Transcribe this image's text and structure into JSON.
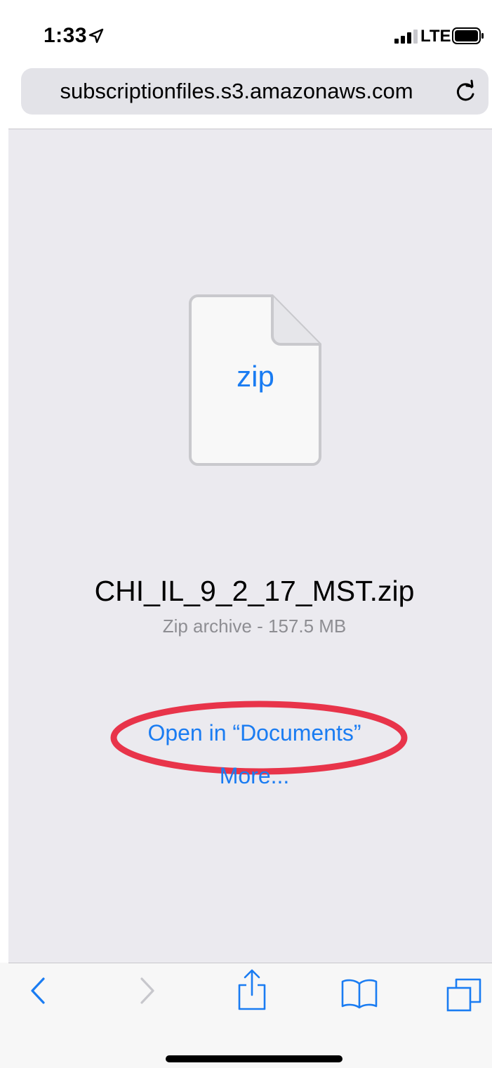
{
  "status_bar": {
    "time": "1:33",
    "network": "LTE",
    "icons": [
      "location-arrow-icon",
      "signal-bars-icon",
      "battery-icon"
    ]
  },
  "url_bar": {
    "url": "subscriptionfiles.s3.amazonaws.com",
    "reload_icon": "reload-icon"
  },
  "download": {
    "file_icon_label": "zip",
    "file_name": "CHI_IL_9_2_17_MST.zip",
    "file_meta": "Zip archive - 157.5 MB",
    "open_in_label": "Open in “Documents”",
    "more_label": "More..."
  },
  "toolbar": {
    "icons": [
      "back-icon",
      "forward-icon",
      "share-icon",
      "bookmarks-icon",
      "tabs-icon"
    ]
  },
  "colors": {
    "accent": "#1a7cf2",
    "highlight_circle": "#e8344a",
    "page_background": "#ebeaef",
    "secondary_text": "#8e8e93"
  }
}
